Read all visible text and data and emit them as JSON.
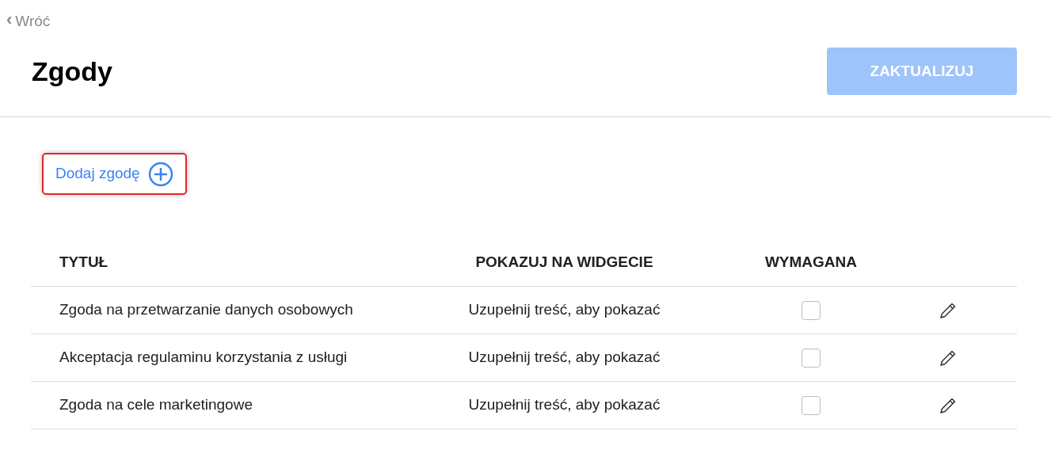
{
  "back_link": {
    "icon": "‹",
    "label": "Wróć"
  },
  "title": "Zgody",
  "update_button": {
    "label": "ZAKTUALIZUJ",
    "disabled": true
  },
  "add_button": {
    "label": "Dodaj zgodę",
    "highlighted": true
  },
  "table": {
    "columns": [
      "TYTUŁ",
      "POKAZUJ NA WIDGECIE",
      "WYMAGANA"
    ],
    "rows": [
      {
        "title": "Zgoda na przetwarzanie danych osobowych",
        "widget": "Uzupełnij treść, aby pokazać",
        "required": false
      },
      {
        "title": "Akceptacja regulaminu korzystania z usługi",
        "widget": "Uzupełnij treść, aby pokazać",
        "required": false
      },
      {
        "title": "Zgoda na cele marketingowe",
        "widget": "Uzupełnij treść, aby pokazać",
        "required": false
      }
    ]
  }
}
